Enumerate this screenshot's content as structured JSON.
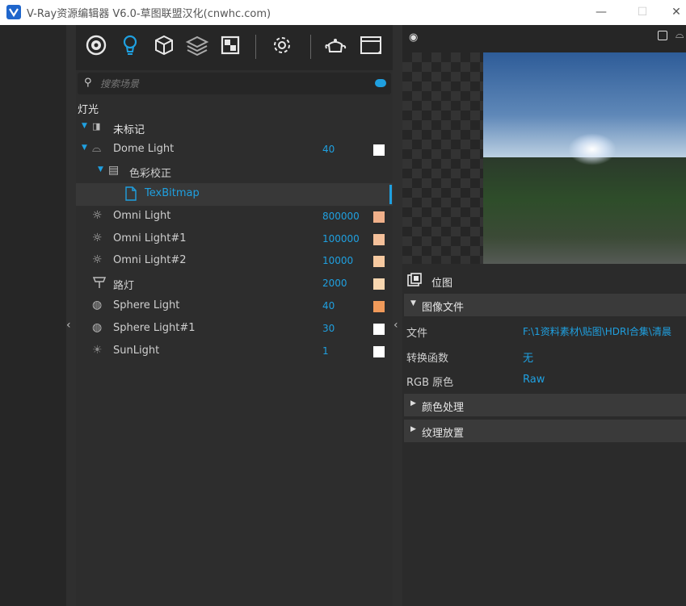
{
  "window": {
    "title": "V-Ray资源编辑器 V6.0-草图联盟汉化(cnwhc.com)",
    "minimize_icon": "minimize-icon",
    "maximize_icon": "maximize-icon",
    "close_icon": "close-icon"
  },
  "toolbar": {
    "icons": [
      "materials-icon",
      "lights-icon",
      "geometry-icon",
      "layers-icon",
      "render-elements-icon",
      "settings-icon",
      "teapot-render-icon",
      "frame-buffer-icon"
    ]
  },
  "search": {
    "placeholder": "搜索场景"
  },
  "scene": {
    "section_title": "灯光",
    "rows": [
      {
        "label": "未标记",
        "value": "",
        "swatch": ""
      },
      {
        "label": "Dome Light",
        "value": "40",
        "swatch": "#ffffff"
      },
      {
        "label": "色彩校正",
        "value": "",
        "swatch": ""
      },
      {
        "label": "TexBitmap",
        "value": "",
        "swatch": ""
      },
      {
        "label": "Omni Light",
        "value": "800000",
        "swatch": "#f0b08a"
      },
      {
        "label": "Omni Light#1",
        "value": "100000",
        "swatch": "#f4c09a"
      },
      {
        "label": "Omni Light#2",
        "value": "10000",
        "swatch": "#f6c9a0"
      },
      {
        "label": "路灯",
        "value": "2000",
        "swatch": "#f8d6b0"
      },
      {
        "label": "Sphere Light",
        "value": "40",
        "swatch": "#f09a5a"
      },
      {
        "label": "Sphere Light#1",
        "value": "30",
        "swatch": "#ffffff"
      },
      {
        "label": "SunLight",
        "value": "1",
        "swatch": "#ffffff"
      }
    ]
  },
  "properties": {
    "header": "位图",
    "image_group": "图像文件",
    "file_label": "文件",
    "file_value": "F:\\1资料素材\\贴图\\HDRI合集\\清晨",
    "transfer_label": "转换函数",
    "transfer_value": "无",
    "rgb_label": "RGB 原色",
    "rgb_value": "Raw",
    "color_group": "颜色处理",
    "texture_group": "纹理放置"
  },
  "colors": {
    "accent": "#1fa0e0",
    "panel": "#2d2d2d",
    "titlebar": "#ffffff"
  }
}
